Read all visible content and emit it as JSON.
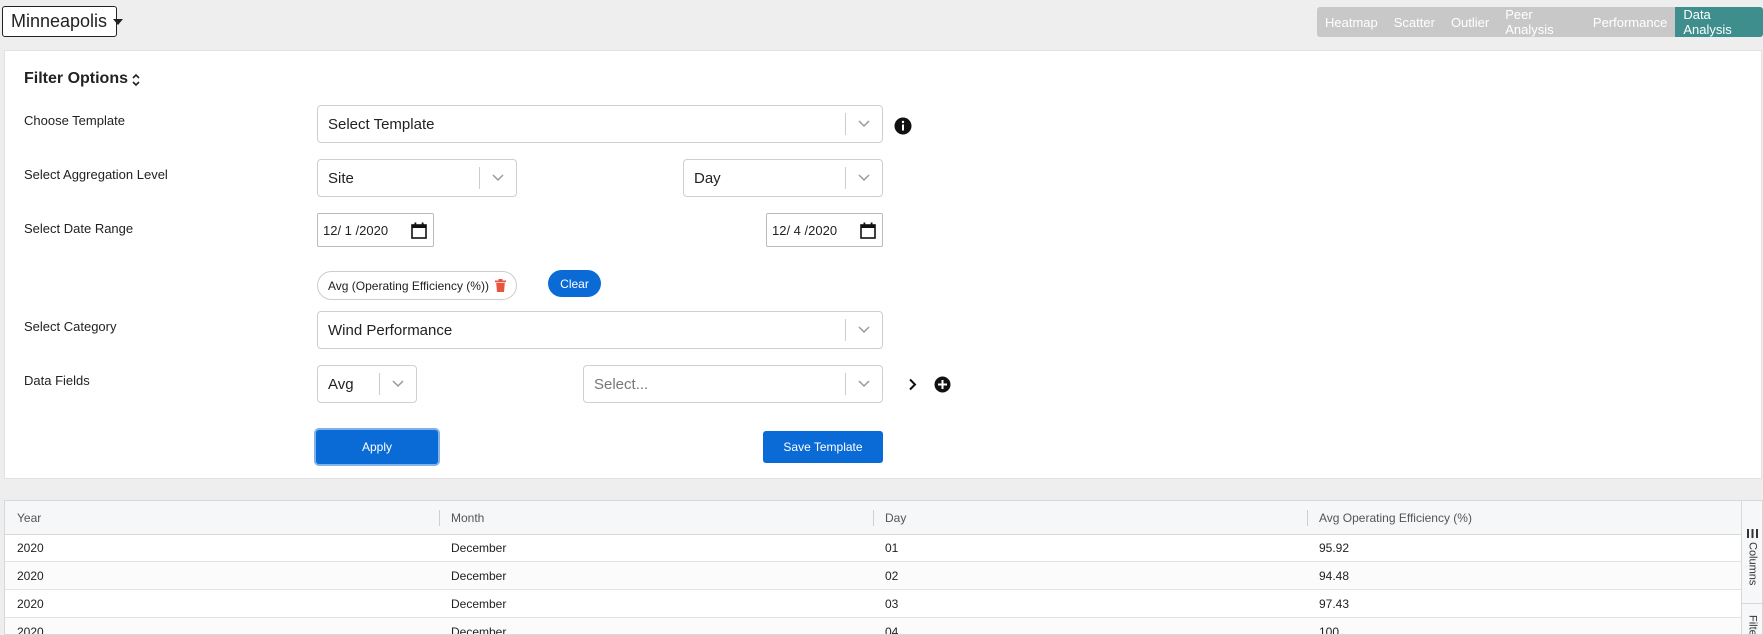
{
  "site_selector": {
    "label": "Minneapolis"
  },
  "nav": {
    "tabs": [
      "Heatmap",
      "Scatter",
      "Outlier",
      "Peer Analysis",
      "Performance",
      "Data Analysis"
    ],
    "active": "Data Analysis"
  },
  "filter": {
    "title": "Filter Options",
    "labels": {
      "template": "Choose Template",
      "aggregation": "Select Aggregation Level",
      "date_range": "Select Date Range",
      "category": "Select Category",
      "data_fields": "Data Fields"
    },
    "template_select": "Select Template",
    "aggregation_level": "Site",
    "aggregation_period": "Day",
    "date_start": "12/ 1 /2020",
    "date_end": "12/ 4 /2020",
    "chip_label": "Avg (Operating Efficiency (%))",
    "clear_label": "Clear",
    "category_select": "Wind Performance",
    "field_agg": "Avg",
    "field_placeholder": "Select...",
    "apply_label": "Apply",
    "save_template_label": "Save Template"
  },
  "table": {
    "columns": [
      "Year",
      "Month",
      "Day",
      "Avg Operating Efficiency (%)"
    ],
    "rows": [
      [
        "2020",
        "December",
        "01",
        "95.92"
      ],
      [
        "2020",
        "December",
        "02",
        "94.48"
      ],
      [
        "2020",
        "December",
        "03",
        "97.43"
      ],
      [
        "2020",
        "December",
        "04",
        "100"
      ]
    ],
    "side_tabs": [
      "Columns",
      "Filters"
    ]
  },
  "colors": {
    "primary": "#0b6bd6",
    "active_tab": "#3e8e8e",
    "trash": "#e8553e"
  },
  "icons": [
    "caret-down-icon",
    "collapse-icon",
    "info-icon",
    "calendar-icon",
    "trash-icon",
    "chevron-right-icon",
    "add-circle-icon",
    "columns-icon",
    "filter-icon"
  ]
}
